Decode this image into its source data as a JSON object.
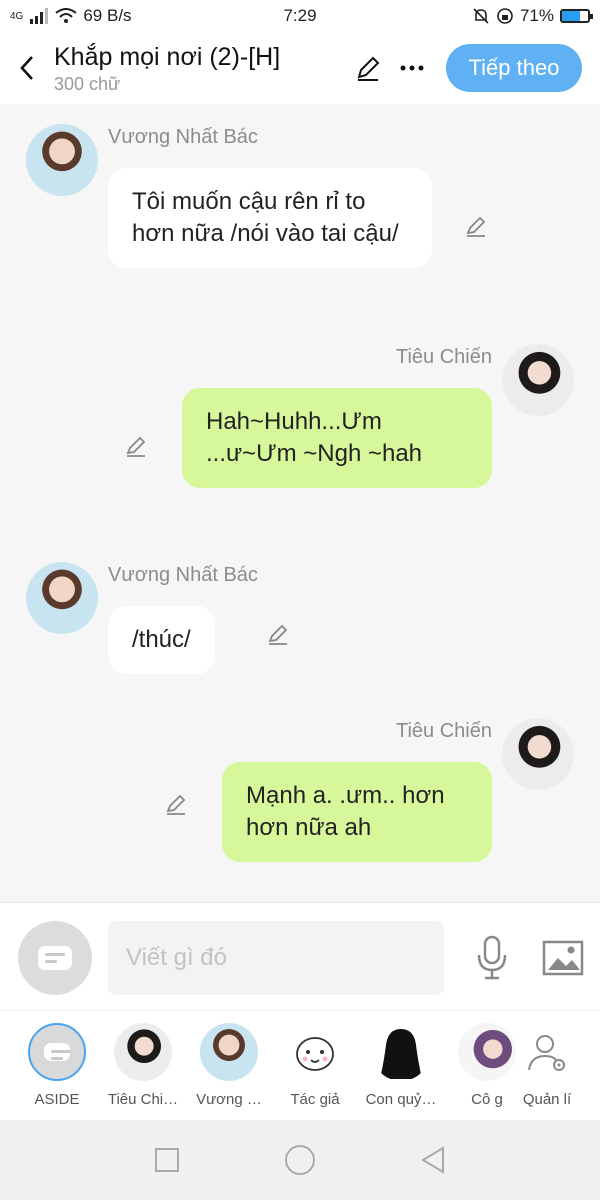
{
  "status_bar": {
    "network": "4G",
    "speed": "69 B/s",
    "time": "7:29",
    "battery": "71%",
    "battery_level": 0.71
  },
  "header": {
    "title": "Khắp mọi nơi (2)-[H]",
    "subtitle": "300 chữ",
    "next_label": "Tiếp theo"
  },
  "messages": [
    {
      "side": "left",
      "sender": "Vương Nhất Bác",
      "text": "Tôi muốn cậu rên rỉ to hơn nữa /nói vào tai cậu/"
    },
    {
      "side": "right",
      "sender": "Tiêu Chiến",
      "text": "Hah~Huhh...Ưm ...ư~Ưm ~Ngh ~hah"
    },
    {
      "side": "left",
      "sender": "Vương Nhất Bác",
      "text": "/thúc/"
    },
    {
      "side": "right",
      "sender": "Tiêu Chiến",
      "text": "Mạnh a. .ưm.. hơn hơn nữa ah"
    }
  ],
  "input": {
    "placeholder": "Viết gì đó"
  },
  "characters": [
    {
      "label": "ASIDE",
      "icon": "aside-icon"
    },
    {
      "label": "Tiêu Chi…",
      "icon": "avatar-tieu-chien"
    },
    {
      "label": "Vương …",
      "icon": "avatar-vuong-nhat-bac"
    },
    {
      "label": "Tác giả",
      "icon": "author-icon"
    },
    {
      "label": "Con quỷ…",
      "icon": "ghost-silhouette-icon"
    },
    {
      "label": "Cô g",
      "icon": "avatar-girl"
    },
    {
      "label": "Quản lí",
      "icon": "manage-user-icon"
    }
  ],
  "colors": {
    "accent": "#5fb1f3",
    "bubble_right": "#d6f79a",
    "bubble_left": "#ffffff",
    "background": "#f6f6f6"
  }
}
